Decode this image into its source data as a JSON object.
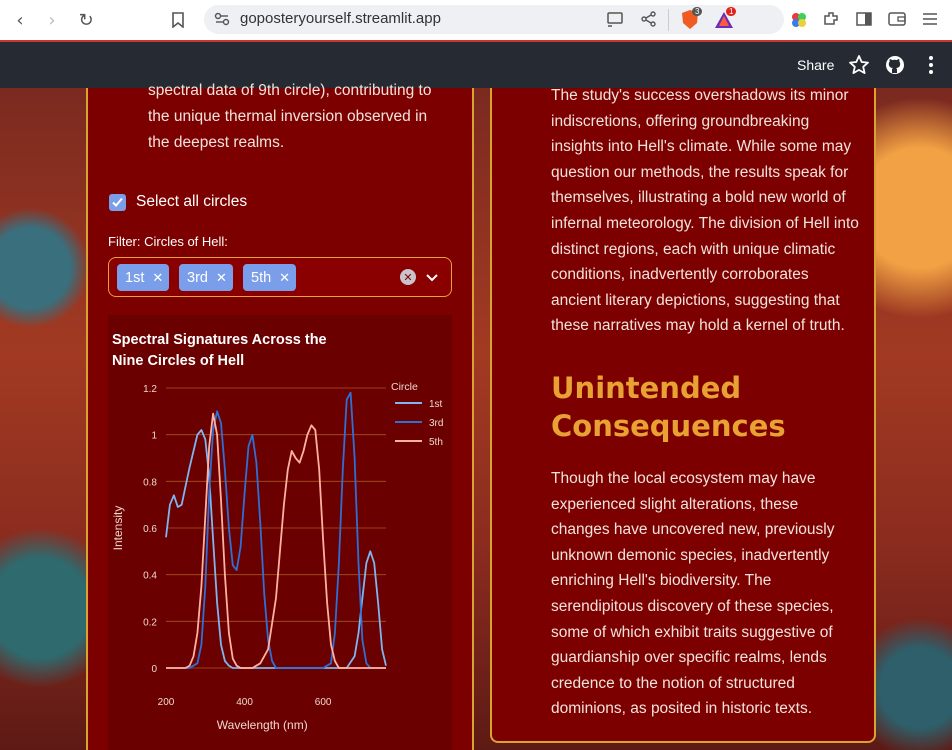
{
  "browser": {
    "url": "goposteryourself.streamlit.app",
    "brave_badge": "3",
    "alert_badge": "1"
  },
  "app_header": {
    "share_label": "Share"
  },
  "left": {
    "intro_text": "spectral data of 9th circle), contributing to the unique thermal inversion observed in the deepest realms.",
    "select_all_label": "Select all circles",
    "select_all_checked": true,
    "filter_label": "Filter: Circles of Hell:",
    "chips": [
      "1st",
      "3rd",
      "5th"
    ]
  },
  "right": {
    "para1": "The study's success overshadows its minor indiscretions, offering groundbreaking insights into Hell's climate. While some may question our methods, the results speak for themselves, illustrating a bold new world of infernal meteorology. The division of Hell into distinct regions, each with unique climatic conditions, inadvertently corroborates ancient literary depictions, suggesting that these narratives may hold a kernel of truth.",
    "heading": "Unintended Consequences",
    "para2": "Though the local ecosystem may have experienced slight alterations, these changes have uncovered new, previously unknown demonic species, inadvertently enriching Hell's biodiversity. The serendipitous discovery of these species, some of which exhibit traits suggestive of guardianship over specific realms, lends credence to the notion of structured dominions, as posited in historic texts."
  },
  "colors": {
    "card_bg": "#7d0000",
    "border_gold": "#d9a32f",
    "heading_gold": "#e7a233",
    "chip_blue": "#7a9eea"
  },
  "chart_data": {
    "type": "line",
    "title": "Spectral Signatures Across the Nine Circles of Hell",
    "title_lines": [
      "Spectral Signatures Across the",
      "Nine Circles of Hell"
    ],
    "xlabel": "Wavelength (nm)",
    "ylabel": "Intensity",
    "xlim": [
      200,
      760
    ],
    "ylim": [
      0,
      1.2
    ],
    "xticks": [
      200,
      400,
      600
    ],
    "yticks": [
      0,
      0.2,
      0.4,
      0.6,
      0.8,
      1,
      1.2
    ],
    "grid": true,
    "legend_title": "Circle",
    "legend_position": "top-right",
    "series": [
      {
        "name": "1st",
        "color": "#7fb5f0",
        "x": [
          200,
          210,
          220,
          230,
          240,
          250,
          260,
          270,
          280,
          290,
          300,
          310,
          320,
          330,
          340,
          350,
          360,
          370,
          380,
          390,
          400,
          410,
          420,
          440,
          460,
          480,
          500,
          520,
          540,
          560,
          580,
          600,
          620,
          640,
          660,
          680,
          690,
          700,
          710,
          720,
          730,
          740,
          750,
          760
        ],
        "y": [
          0.56,
          0.7,
          0.74,
          0.69,
          0.7,
          0.78,
          0.86,
          0.93,
          1.0,
          1.02,
          0.98,
          0.82,
          0.55,
          0.28,
          0.1,
          0.03,
          0.01,
          0.0,
          0.0,
          0.0,
          0.0,
          0.0,
          0.0,
          0.0,
          0.0,
          0.0,
          0.0,
          0.0,
          0.0,
          0.0,
          0.0,
          0.0,
          0.0,
          0.0,
          0.0,
          0.05,
          0.15,
          0.3,
          0.45,
          0.5,
          0.45,
          0.28,
          0.08,
          0.01
        ]
      },
      {
        "name": "3rd",
        "color": "#2f6fd6",
        "x": [
          200,
          240,
          260,
          280,
          290,
          300,
          310,
          320,
          330,
          340,
          350,
          360,
          370,
          380,
          390,
          400,
          410,
          420,
          430,
          440,
          450,
          460,
          470,
          480,
          500,
          520,
          540,
          560,
          580,
          600,
          620,
          630,
          640,
          650,
          660,
          670,
          680,
          690,
          700,
          710,
          720,
          760
        ],
        "y": [
          0.0,
          0.0,
          0.0,
          0.02,
          0.1,
          0.35,
          0.75,
          1.02,
          1.1,
          1.05,
          0.85,
          0.6,
          0.44,
          0.42,
          0.52,
          0.75,
          0.95,
          1.0,
          0.88,
          0.62,
          0.32,
          0.12,
          0.03,
          0.0,
          0.0,
          0.0,
          0.0,
          0.0,
          0.0,
          0.0,
          0.02,
          0.15,
          0.45,
          0.85,
          1.15,
          1.18,
          0.9,
          0.45,
          0.12,
          0.02,
          0.0,
          0.0
        ]
      },
      {
        "name": "5th",
        "color": "#ffb1a0",
        "x": [
          200,
          250,
          260,
          270,
          280,
          290,
          300,
          310,
          320,
          330,
          340,
          350,
          360,
          370,
          380,
          390,
          400,
          410,
          420,
          440,
          460,
          480,
          500,
          510,
          520,
          530,
          540,
          550,
          560,
          570,
          580,
          590,
          600,
          610,
          620,
          630,
          640,
          660,
          700,
          760
        ],
        "y": [
          0.0,
          0.0,
          0.01,
          0.05,
          0.15,
          0.35,
          0.65,
          0.95,
          1.09,
          1.0,
          0.72,
          0.4,
          0.15,
          0.04,
          0.01,
          0.0,
          0.0,
          0.0,
          0.0,
          0.02,
          0.08,
          0.3,
          0.7,
          0.85,
          0.93,
          0.9,
          0.88,
          0.93,
          1.0,
          1.04,
          1.02,
          0.85,
          0.55,
          0.28,
          0.1,
          0.03,
          0.0,
          0.0,
          0.0,
          0.0
        ]
      }
    ]
  }
}
